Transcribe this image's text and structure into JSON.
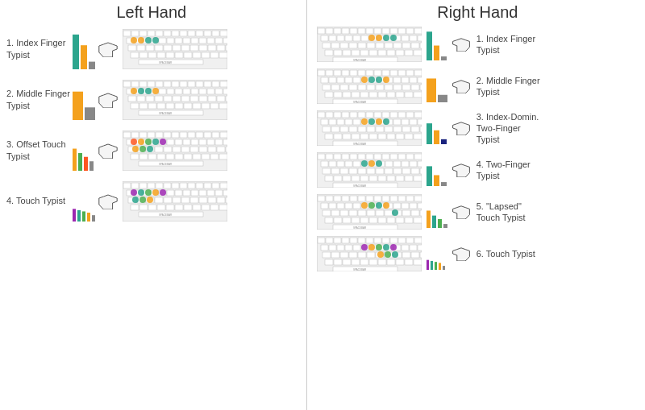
{
  "leftHeader": "Left Hand",
  "rightHeader": "Right Hand",
  "leftTypists": [
    {
      "number": "1.",
      "label": "Index Finger\nTypist",
      "bars": [
        {
          "height": 55,
          "color": "#2ca58d"
        },
        {
          "height": 38,
          "color": "#f4a11d"
        },
        {
          "height": 12,
          "color": "#888"
        }
      ],
      "dotColors": [
        "#f4a11d",
        "#f4a11d",
        "#2ca58d",
        "#2ca58d",
        "#888",
        "#888",
        "#888",
        "#888",
        "#888",
        "#888",
        "#888",
        "#888"
      ]
    },
    {
      "number": "2.",
      "label": "Middle Finger\nTypist",
      "bars": [
        {
          "height": 45,
          "color": "#f4a11d"
        },
        {
          "height": 20,
          "color": "#888"
        }
      ],
      "dotColors": [
        "#f4a11d",
        "#2ca58d",
        "#2ca58d",
        "#f4a11d",
        "#888",
        "#888",
        "#888",
        "#888",
        "#888",
        "#888",
        "#888",
        "#888"
      ]
    },
    {
      "number": "3.",
      "label": "Offset Touch\nTypist",
      "bars": [
        {
          "height": 35,
          "color": "#f4a11d"
        },
        {
          "height": 28,
          "color": "#4caf50"
        },
        {
          "height": 22,
          "color": "#ff5722"
        },
        {
          "height": 15,
          "color": "#888"
        }
      ],
      "dotColors": [
        "#ff5722",
        "#f4a11d",
        "#4caf50",
        "#2ca58d",
        "#9c27b0",
        "#f4a11d",
        "#4caf50",
        "#2ca58d",
        "#888",
        "#888",
        "#888",
        "#888"
      ]
    },
    {
      "number": "4.",
      "label": "Touch Typist",
      "bars": [
        {
          "height": 20,
          "color": "#9c27b0"
        },
        {
          "height": 18,
          "color": "#2ca58d"
        },
        {
          "height": 16,
          "color": "#4caf50"
        },
        {
          "height": 14,
          "color": "#f4a11d"
        },
        {
          "height": 10,
          "color": "#888"
        }
      ],
      "dotColors": [
        "#9c27b0",
        "#2ca58d",
        "#4caf50",
        "#f4a11d",
        "#9c27b0",
        "#2ca58d",
        "#4caf50",
        "#f4a11d",
        "#888",
        "#888",
        "#888",
        "#888"
      ]
    }
  ],
  "rightTypists": [
    {
      "number": "1.",
      "label": "Index Finger\nTypist",
      "bars": [
        {
          "height": 58,
          "color": "#2ca58d"
        },
        {
          "height": 30,
          "color": "#f4a11d"
        },
        {
          "height": 8,
          "color": "#888"
        }
      ],
      "dotColors": [
        "#2ca58d",
        "#2ca58d",
        "#f4a11d",
        "#f4a11d",
        "#888",
        "#888",
        "#888",
        "#888",
        "#888",
        "#888",
        "#888",
        "#888"
      ]
    },
    {
      "number": "2.",
      "label": "Middle Finger\nTypist",
      "bars": [
        {
          "height": 48,
          "color": "#f4a11d"
        },
        {
          "height": 15,
          "color": "#888"
        }
      ],
      "dotColors": [
        "#888",
        "#f4a11d",
        "#2ca58d",
        "#2ca58d",
        "#f4a11d",
        "#888",
        "#888",
        "#888",
        "#888",
        "#888",
        "#888",
        "#888"
      ]
    },
    {
      "number": "3.",
      "label": "Index-Domin.\nTwo-Finger\nTypist",
      "bars": [
        {
          "height": 42,
          "color": "#2ca58d"
        },
        {
          "height": 28,
          "color": "#f4a11d"
        },
        {
          "height": 10,
          "color": "#1a237e"
        }
      ],
      "dotColors": [
        "#888",
        "#2ca58d",
        "#f4a11d",
        "#2ca58d",
        "#f4a11d",
        "#888",
        "#888",
        "#888",
        "#888",
        "#888",
        "#888",
        "#888"
      ]
    },
    {
      "number": "4.",
      "label": "Two-Finger\nTypist",
      "bars": [
        {
          "height": 40,
          "color": "#2ca58d"
        },
        {
          "height": 22,
          "color": "#f4a11d"
        },
        {
          "height": 8,
          "color": "#888"
        }
      ],
      "dotColors": [
        "#888",
        "#888",
        "#2ca58d",
        "#f4a11d",
        "#2ca58d",
        "#888",
        "#888",
        "#888",
        "#888",
        "#888",
        "#888",
        "#888"
      ]
    },
    {
      "number": "5.",
      "label": "\"Lapsed\"\nTouch Typist",
      "bars": [
        {
          "height": 35,
          "color": "#f4a11d"
        },
        {
          "height": 25,
          "color": "#2ca58d"
        },
        {
          "height": 18,
          "color": "#4caf50"
        },
        {
          "height": 8,
          "color": "#888"
        }
      ],
      "dotColors": [
        "#888",
        "#f4a11d",
        "#2ca58d",
        "#4caf50",
        "#f4a11d",
        "#2ca58d",
        "#888",
        "#888",
        "#888",
        "#888",
        "#888",
        "#888"
      ]
    },
    {
      "number": "6.",
      "label": "Touch Typist",
      "bars": [
        {
          "height": 20,
          "color": "#9c27b0"
        },
        {
          "height": 18,
          "color": "#2ca58d"
        },
        {
          "height": 16,
          "color": "#4caf50"
        },
        {
          "height": 14,
          "color": "#f4a11d"
        },
        {
          "height": 8,
          "color": "#888"
        }
      ],
      "dotColors": [
        "#9c27b0",
        "#2ca58d",
        "#4caf50",
        "#f4a11d",
        "#9c27b0",
        "#2ca58d",
        "#4caf50",
        "#f4a11d",
        "#888",
        "#888",
        "#888",
        "#888"
      ]
    }
  ]
}
